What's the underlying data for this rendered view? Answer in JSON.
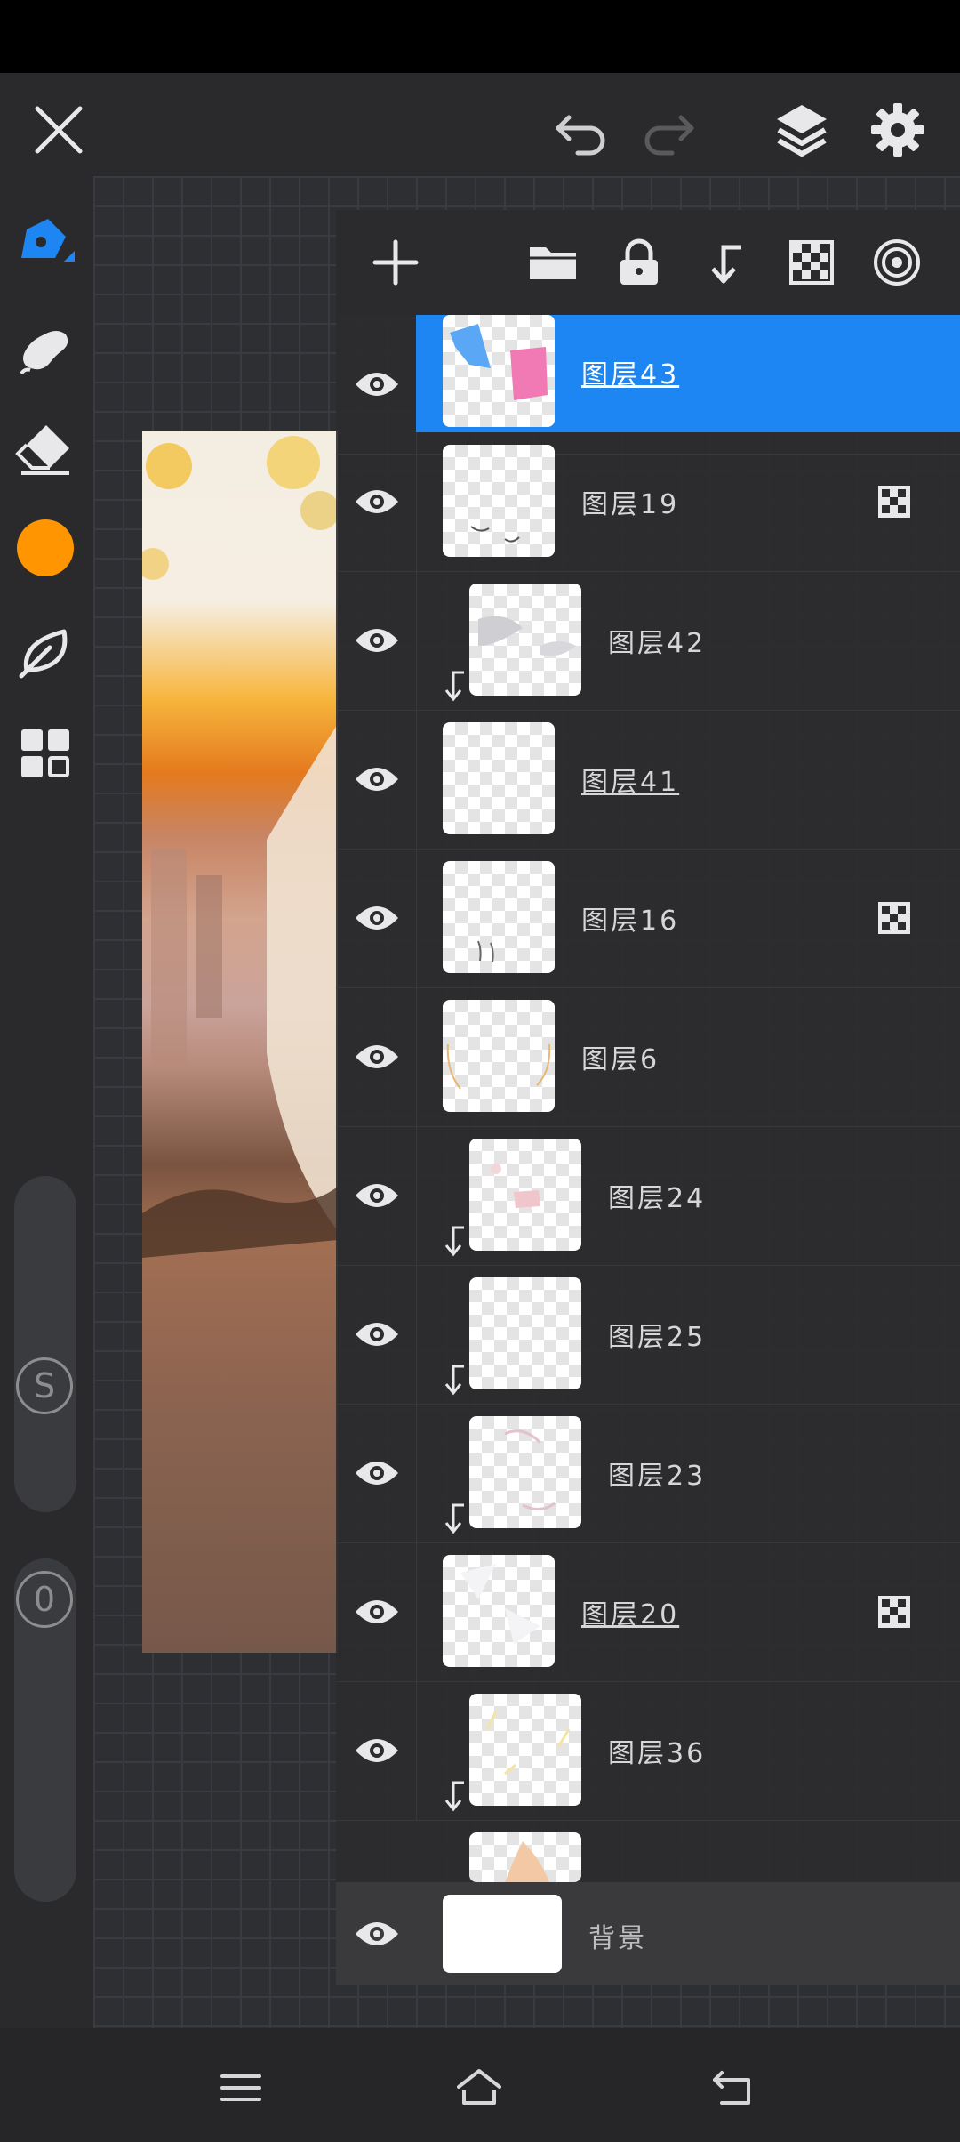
{
  "colors": {
    "accent": "#1e86f2",
    "current_color": "#ff9500",
    "icon": "#e8e8ea",
    "muted_icon": "#8d8d90"
  },
  "top_bar": {
    "close_icon": "close-icon",
    "undo_icon": "undo-icon",
    "redo_icon": "redo-icon",
    "layers_icon": "layers-icon",
    "settings_icon": "gear-icon"
  },
  "tools": [
    {
      "name": "pen-tool",
      "icon": "pen-icon",
      "active": true
    },
    {
      "name": "smudge-tool",
      "icon": "smudge-icon"
    },
    {
      "name": "eraser-tool",
      "icon": "eraser-icon"
    },
    {
      "name": "color-swatch",
      "icon": "color-circle"
    },
    {
      "name": "leaf-tool",
      "icon": "leaf-icon"
    },
    {
      "name": "more-tools",
      "icon": "grid-icon"
    }
  ],
  "sliders": {
    "size_label": "S",
    "opacity_label": "0"
  },
  "layer_panel": {
    "toolbar": [
      "add-layer-icon",
      "folder-icon",
      "lock-icon",
      "clip-icon",
      "checkerboard-icon",
      "blend-icon"
    ],
    "layers": [
      {
        "name": "图层43",
        "underlined": true,
        "selected": true,
        "clipped": false,
        "alpha_lock": false
      },
      {
        "name": "图层19",
        "underlined": false,
        "selected": false,
        "clipped": false,
        "alpha_lock": true
      },
      {
        "name": "图层42",
        "underlined": false,
        "selected": false,
        "clipped": true,
        "alpha_lock": false
      },
      {
        "name": "图层41",
        "underlined": true,
        "selected": false,
        "clipped": false,
        "alpha_lock": false
      },
      {
        "name": "图层16",
        "underlined": false,
        "selected": false,
        "clipped": false,
        "alpha_lock": true
      },
      {
        "name": "图层6",
        "underlined": false,
        "selected": false,
        "clipped": false,
        "alpha_lock": false
      },
      {
        "name": "图层24",
        "underlined": false,
        "selected": false,
        "clipped": true,
        "alpha_lock": false
      },
      {
        "name": "图层25",
        "underlined": false,
        "selected": false,
        "clipped": true,
        "alpha_lock": false
      },
      {
        "name": "图层23",
        "underlined": false,
        "selected": false,
        "clipped": true,
        "alpha_lock": false
      },
      {
        "name": "图层20",
        "underlined": true,
        "selected": false,
        "clipped": false,
        "alpha_lock": true
      },
      {
        "name": "图层36",
        "underlined": false,
        "selected": false,
        "clipped": true,
        "alpha_lock": false
      }
    ],
    "background_layer": {
      "name": "背景"
    }
  },
  "nav_bar": {
    "icons": [
      "menu-icon",
      "home-icon",
      "back-icon"
    ]
  }
}
